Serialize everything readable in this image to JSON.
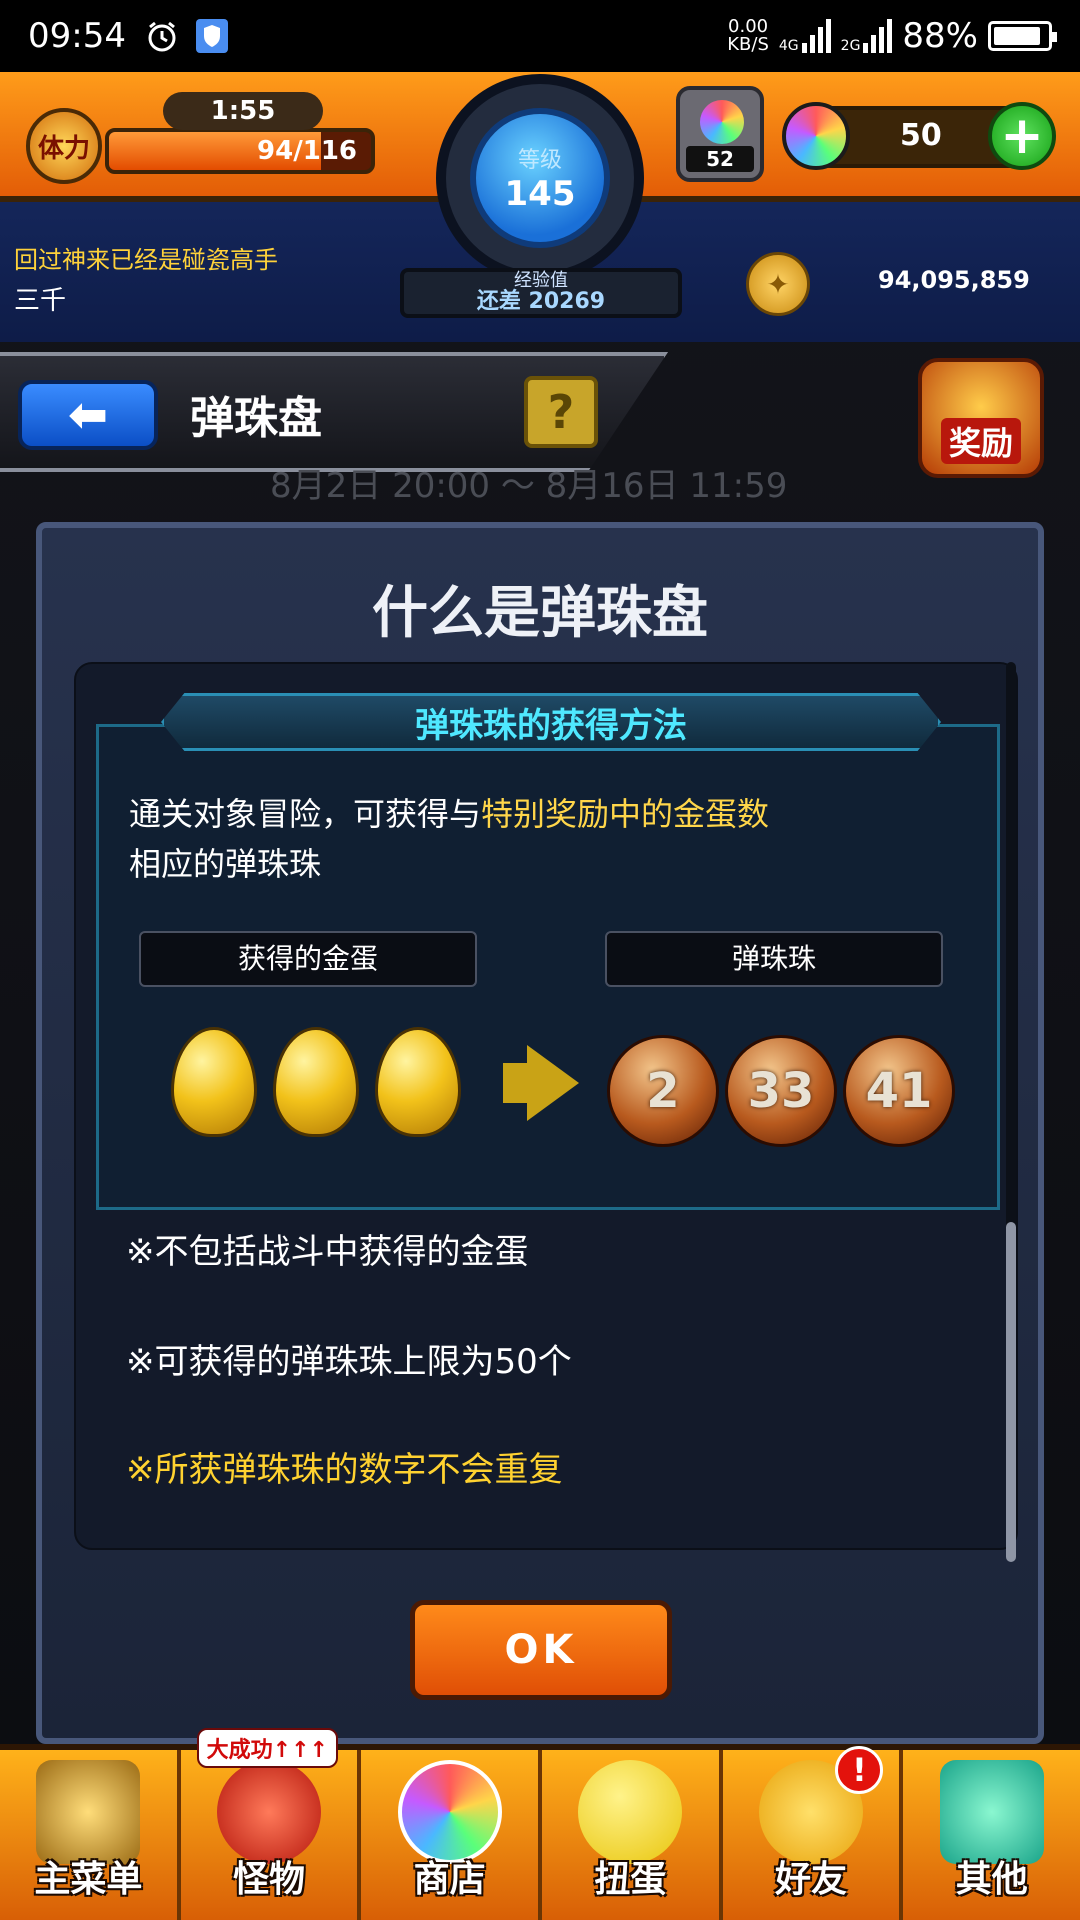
{
  "status_bar": {
    "time": "09:54",
    "net_speed_value": "0.00",
    "net_speed_unit": "KB/S",
    "signal_1": "4G",
    "signal_2": "2G",
    "battery": "88%"
  },
  "hud": {
    "stamina_label": "体力",
    "stamina_timer": "1:55",
    "stamina_value": "94/116",
    "stamina_fraction": 0.81,
    "level_label": "等级",
    "level": "145",
    "exp_label": "经验值",
    "exp_remaining": "还差 20269",
    "orb_count": "52",
    "stones": "50",
    "username": "回过神来已经是碰瓷高手",
    "subname": "三千",
    "gold": "94,095,859"
  },
  "header": {
    "title": "弹珠盘",
    "help": "?",
    "date_range": "8月2日 20:00 ～ 8月16日 11:59",
    "reward_label": "奖励"
  },
  "dialog": {
    "title": "什么是弹珠盘",
    "section_title": "弹珠珠的获得方法",
    "desc_part1": "通关对象冒险，可获得与",
    "desc_highlight": "特别奖励中的金蛋数",
    "desc_part2": "相应的弹珠珠",
    "col_eggs": "获得的金蛋",
    "col_marbles": "弹珠珠",
    "marbles": [
      "2",
      "33",
      "41"
    ],
    "notes": [
      "※不包括战斗中获得的金蛋",
      "※可获得的弹珠珠上限为50个",
      "※所获弹珠珠的数字不会重复"
    ],
    "ok_label": "OK"
  },
  "bottom_nav": {
    "items": [
      {
        "label": "主菜单"
      },
      {
        "label": "怪物",
        "badge": "大成功↑↑↑"
      },
      {
        "label": "商店"
      },
      {
        "label": "扭蛋"
      },
      {
        "label": "好友",
        "alert": "!"
      },
      {
        "label": "其他"
      }
    ]
  },
  "colors": {
    "accent_orange": "#e35d07",
    "highlight_yellow": "#ffd64a",
    "section_cyan": "#4fe8ff"
  }
}
